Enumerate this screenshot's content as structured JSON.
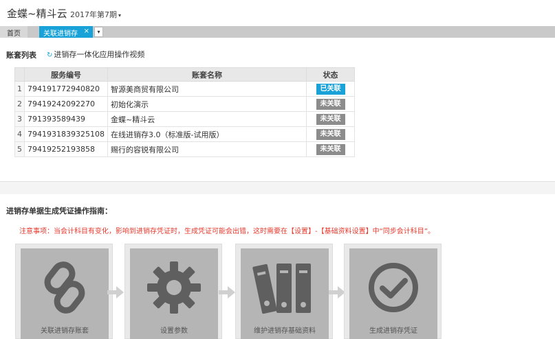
{
  "header": {
    "app_title": "金蝶~精斗云",
    "period": "2017年第7期"
  },
  "tabs": {
    "home": "首页",
    "active": "关联进销存",
    "close_glyph": "×",
    "more_glyph": "▾"
  },
  "accounts": {
    "section_title": "账套列表",
    "video_link": "进销存一体化应用操作视频",
    "columns": [
      "服务编号",
      "账套名称",
      "状态"
    ],
    "rows": [
      {
        "idx": "1",
        "code": "794191772940820",
        "name": "智源美商贸有限公司",
        "status": "已关联",
        "linked": true
      },
      {
        "idx": "2",
        "code": "79419242092270",
        "name": "初始化演示",
        "status": "未关联",
        "linked": false
      },
      {
        "idx": "3",
        "code": "791393589439",
        "name": "金蝶~精斗云",
        "status": "未关联",
        "linked": false
      },
      {
        "idx": "4",
        "code": "7941931839325108",
        "name": "在线进销存3.0（标准版-试用版）",
        "status": "未关联",
        "linked": false
      },
      {
        "idx": "5",
        "code": "79419252193858",
        "name": "赐行的容锐有限公司",
        "status": "未关联",
        "linked": false
      }
    ]
  },
  "guide": {
    "title": "进销存单据生成凭证操作指南：",
    "note": "注意事项：当会计科目有变化，影响到进销存凭证时，生成凭证可能会出错，这时需要在【设置】-【基础资料设置】中“同步会计科目”。",
    "steps": [
      {
        "label": "关联进销存账套",
        "icon": "link-icon"
      },
      {
        "label": "设置参数",
        "icon": "gear-icon"
      },
      {
        "label": "维护进销存基础资料",
        "icon": "binders-icon"
      },
      {
        "label": "生成进销存凭证",
        "icon": "check-circle-icon"
      }
    ]
  },
  "colors": {
    "accent": "#18a2d8",
    "unlinked": "#8c8c8c",
    "warning": "#e63a2e",
    "step_bg": "#b5b5b5",
    "icon": "#5f5f5f"
  }
}
